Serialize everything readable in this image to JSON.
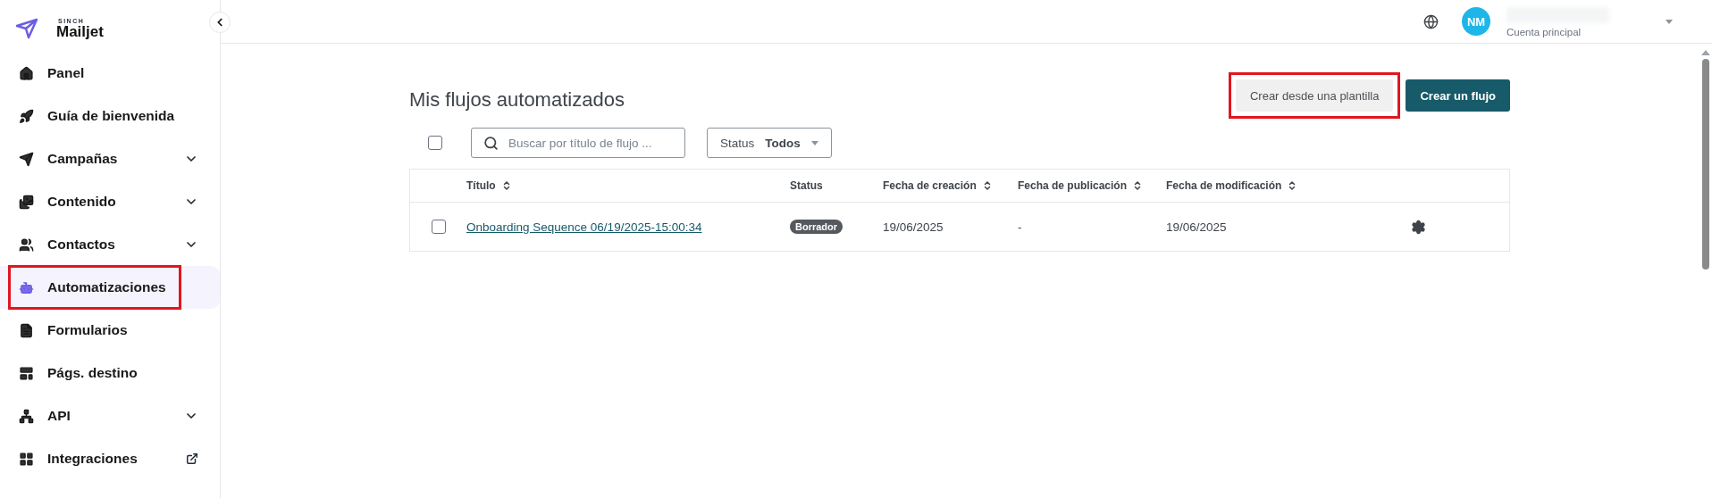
{
  "brand": {
    "super": "SINCH",
    "name": "Mailjet"
  },
  "sidebar": {
    "items": [
      {
        "label": "Panel",
        "selected": false,
        "highlighted": false,
        "kind": "link"
      },
      {
        "label": "Guía de bienvenida",
        "selected": false,
        "highlighted": false,
        "kind": "link"
      },
      {
        "label": "Campañas",
        "selected": false,
        "highlighted": false,
        "kind": "group"
      },
      {
        "label": "Contenido",
        "selected": false,
        "highlighted": false,
        "kind": "group"
      },
      {
        "label": "Contactos",
        "selected": false,
        "highlighted": false,
        "kind": "group"
      },
      {
        "label": "Automatizaciones",
        "selected": true,
        "highlighted": true,
        "kind": "link"
      },
      {
        "label": "Formularios",
        "selected": false,
        "highlighted": false,
        "kind": "link"
      },
      {
        "label": "Págs. destino",
        "selected": false,
        "highlighted": false,
        "kind": "link"
      },
      {
        "label": "API",
        "selected": false,
        "highlighted": false,
        "kind": "group"
      },
      {
        "label": "Integraciones",
        "selected": false,
        "highlighted": false,
        "kind": "external"
      }
    ]
  },
  "header": {
    "avatar": "NM",
    "account": "Cuenta principal"
  },
  "page": {
    "title": "Mis flujos automatizados",
    "buttons": [
      {
        "label": "Crear desde una plantilla",
        "kind": "secondary",
        "highlighted": true
      },
      {
        "label": "Crear un flujo",
        "kind": "primary",
        "highlighted": false
      }
    ],
    "search": {
      "placeholder": "Buscar por título de flujo ..."
    },
    "filter": {
      "label": "Status",
      "value": "Todos"
    },
    "select_all": {
      "checked": false
    }
  },
  "table": {
    "columns": [
      {
        "label": "Título",
        "sortable": true
      },
      {
        "label": "Status",
        "sortable": false
      },
      {
        "label": "Fecha de creación",
        "sortable": true
      },
      {
        "label": "Fecha de publicación",
        "sortable": true
      },
      {
        "label": "Fecha de modificación",
        "sortable": true
      }
    ],
    "rows": [
      {
        "checked": false,
        "title": "Onboarding Sequence 06/19/2025-15:00:34",
        "status": "Borrador",
        "created": "19/06/2025",
        "published": "-",
        "modified": "19/06/2025"
      }
    ]
  }
}
